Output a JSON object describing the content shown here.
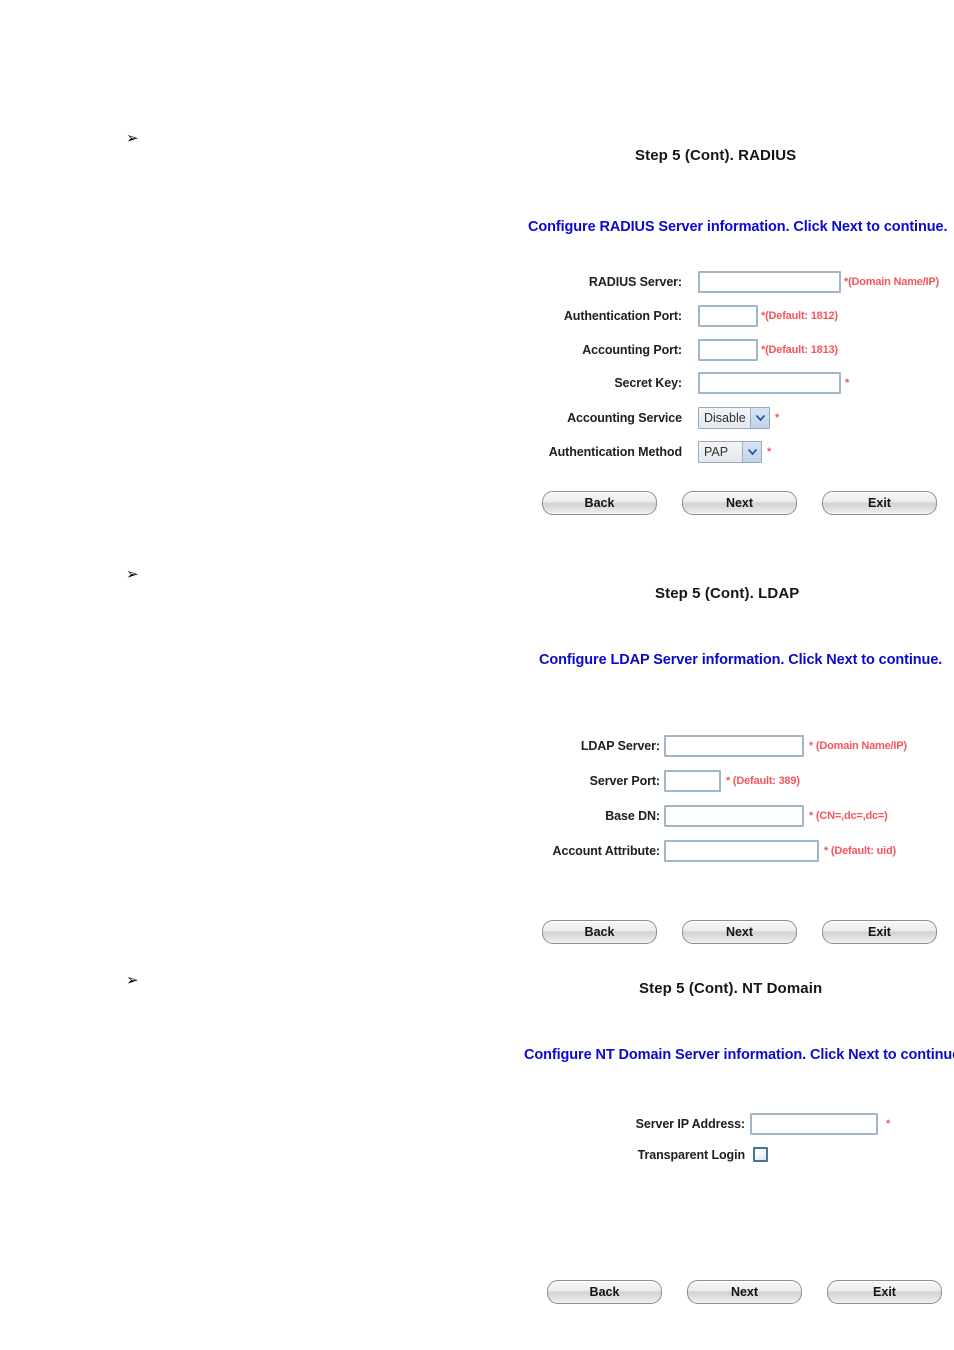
{
  "bullets": {
    "glyph": "➢"
  },
  "buttons": {
    "back": "Back",
    "next": "Next",
    "exit": "Exit"
  },
  "sections": [
    {
      "id": "radius",
      "heading": "Step 5 (Cont). RADIUS",
      "instruction": "Configure RADIUS Server information. Click Next to continue.",
      "fields": [
        {
          "label": "RADIUS Server:",
          "type": "text",
          "value": "",
          "hint": "*(Domain Name/IP)"
        },
        {
          "label": "Authentication Port:",
          "type": "text",
          "value": "",
          "hint": "*(Default: 1812)"
        },
        {
          "label": "Accounting Port:",
          "type": "text",
          "value": "",
          "hint": "*(Default: 1813)"
        },
        {
          "label": "Secret Key:",
          "type": "text",
          "value": "",
          "hint": "*"
        },
        {
          "label": "Accounting Service",
          "type": "select",
          "value": "Disable",
          "hint": "*"
        },
        {
          "label": "Authentication Method",
          "type": "select",
          "value": "PAP",
          "hint": "*"
        }
      ]
    },
    {
      "id": "ldap",
      "heading": "Step 5 (Cont). LDAP",
      "instruction": "Configure LDAP Server information. Click Next to continue.",
      "fields": [
        {
          "label": "LDAP Server:",
          "type": "text",
          "value": "",
          "hint": "* (Domain Name/IP)"
        },
        {
          "label": "Server Port:",
          "type": "text",
          "value": "",
          "hint": "* (Default: 389)"
        },
        {
          "label": "Base DN:",
          "type": "text",
          "value": "",
          "hint": "* (CN=,dc=,dc=)"
        },
        {
          "label": "Account Attribute:",
          "type": "text",
          "value": "",
          "hint": "* (Default: uid)"
        }
      ]
    },
    {
      "id": "ntdomain",
      "heading": "Step 5 (Cont). NT Domain",
      "instruction": "Configure NT Domain Server information. Click Next to continue.",
      "fields": [
        {
          "label": "Server IP Address:",
          "type": "text",
          "value": "",
          "hint": "*"
        },
        {
          "label": "Transparent Login",
          "type": "checkbox",
          "checked": false,
          "hint": ""
        }
      ]
    }
  ],
  "colors": {
    "instruction_blue": "#0a0acc",
    "hint_red": "#f4565c",
    "input_border": "#a3b6c9",
    "heading": "#161616"
  }
}
